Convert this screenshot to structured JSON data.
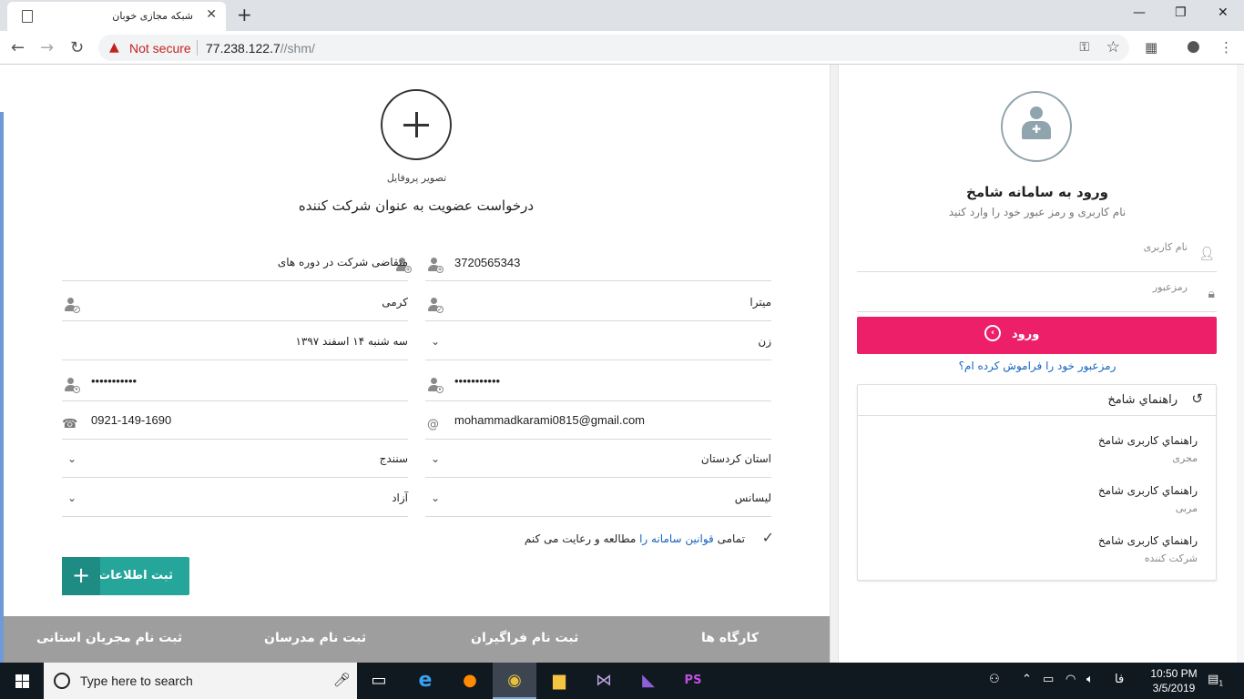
{
  "browser": {
    "tab_title": "شبکه مجازی خوبان",
    "security_label": "Not secure",
    "url_host": "77.238.122.7",
    "url_path": "//shm/"
  },
  "form": {
    "profile_label": "تصویر پروفایل",
    "title": "درخواست عضویت به عنوان شرکت کننده",
    "national_id": "3720565343",
    "participation_request": "متقاضی شرکت در دوره های",
    "first_name": "میترا",
    "last_name": "کرمی",
    "gender": "زن",
    "birth_date": "سه شنبه ۱۴ اسفند ۱۳۹۷",
    "password": "•••••••••••",
    "password_confirm": "•••••••••••",
    "email": "mohammadkarami0815@gmail.com",
    "phone": "0921-149-1690",
    "province": "استان کردستان",
    "city": "سنندج",
    "education": "لیسانس",
    "university": "آزاد",
    "terms_prefix": "تمامی",
    "terms_link": "قوانین سامانه را",
    "terms_suffix": "مطالعه و رعایت می کنم",
    "submit_label": "ثبت اطلاعات"
  },
  "footer_nav": {
    "items": [
      "کارگاه ها",
      "ثبت نام فراگیران",
      "ثبت نام مدرسان",
      "ثبت نام مجریان استانی"
    ]
  },
  "login": {
    "title": "ورود به سامانه شامخ",
    "subtitle": "نام کاربری و رمز عبور خود را وارد کنید",
    "username_placeholder": "نام کاربری",
    "password_placeholder": "رمزعبور",
    "login_label": "ورود",
    "forgot_link": "رمزعبور خود را فراموش کرده ام؟"
  },
  "guide": {
    "title": "راهنماي شامخ",
    "items": [
      {
        "name": "راهنماي کاربری شامخ",
        "role": "مجری"
      },
      {
        "name": "راهنماي کاربری شامخ",
        "role": "مربی"
      },
      {
        "name": "راهنماي کاربری شامخ",
        "role": "شرکت کننده"
      }
    ]
  },
  "taskbar": {
    "search_placeholder": "Type here to search",
    "lang": "فا",
    "time": "10:50 PM",
    "date": "3/5/2019",
    "notification_count": "1"
  },
  "colors": {
    "accent_teal": "#26a69a",
    "login_pink": "#ec1f68",
    "link_blue": "#1565c0",
    "footer_gray": "#9e9e9e"
  },
  "icons": [
    "page-icon",
    "warning-icon",
    "key-icon",
    "star-icon",
    "plus-icon",
    "person-icon",
    "phone-icon",
    "at-icon",
    "chevron-down-icon",
    "check-icon",
    "lock-icon",
    "history-icon",
    "arrow-circle-icon",
    "windows-icon",
    "microphone-icon"
  ]
}
